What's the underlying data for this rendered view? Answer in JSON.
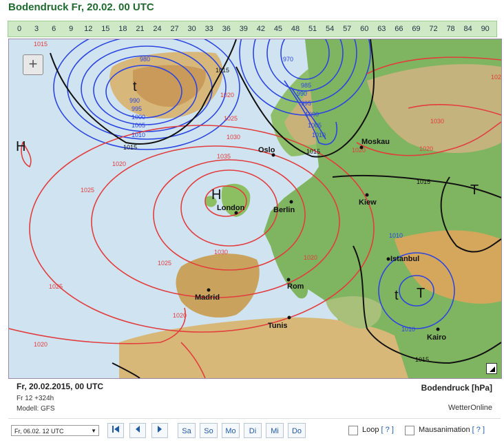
{
  "header": {
    "title": "Bodendruck Fr, 20.02. 00 UTC"
  },
  "hours": [
    "0",
    "3",
    "6",
    "9",
    "12",
    "15",
    "18",
    "21",
    "24",
    "27",
    "30",
    "33",
    "36",
    "39",
    "42",
    "45",
    "48",
    "51",
    "54",
    "57",
    "60",
    "63",
    "66",
    "69",
    "72",
    "78",
    "84",
    "90"
  ],
  "map": {
    "zoom_label": "+",
    "cities": [
      "Oslo",
      "Moskau",
      "London",
      "Berlin",
      "Kiew",
      "Istanbul",
      "Madrid",
      "Rom",
      "Tunis",
      "Kairo"
    ],
    "pressure_centers": [
      "H",
      "H",
      "t",
      "T",
      "t",
      "T"
    ],
    "isobar_labels_blue": [
      "980",
      "990",
      "995",
      "1000",
      "1005",
      "1010",
      "970",
      "985",
      "990",
      "995",
      "1000",
      "1005",
      "1010",
      "1010",
      "1010"
    ],
    "isobar_labels_red": [
      "1015",
      "1020",
      "1025",
      "1020",
      "1025",
      "1030",
      "1035",
      "1030",
      "1025",
      "1025",
      "1020",
      "1020",
      "1020",
      "1025",
      "1020",
      "1030",
      "1020"
    ],
    "isobar_labels_black": [
      "1015",
      "1015",
      "1015",
      "1015",
      "1015"
    ]
  },
  "info": {
    "date": "Fr, 20.02.2015, 00 UTC",
    "run": "Fr 12 +324h",
    "model": "Modell: GFS",
    "product": "Bodendruck [hPa]",
    "brand": "WetterOnline"
  },
  "controls": {
    "run_select": "Fr, 06.02. 12 UTC",
    "first_icon": "first-icon",
    "prev_icon": "prev-icon",
    "next_icon": "next-icon",
    "days": [
      "Sa",
      "So",
      "Mo",
      "Di",
      "Mi",
      "Do"
    ],
    "loop_label": "Loop",
    "loop_help": "[ ? ]",
    "mouse_label": "Mausanimation",
    "mouse_help": "[ ? ]"
  }
}
